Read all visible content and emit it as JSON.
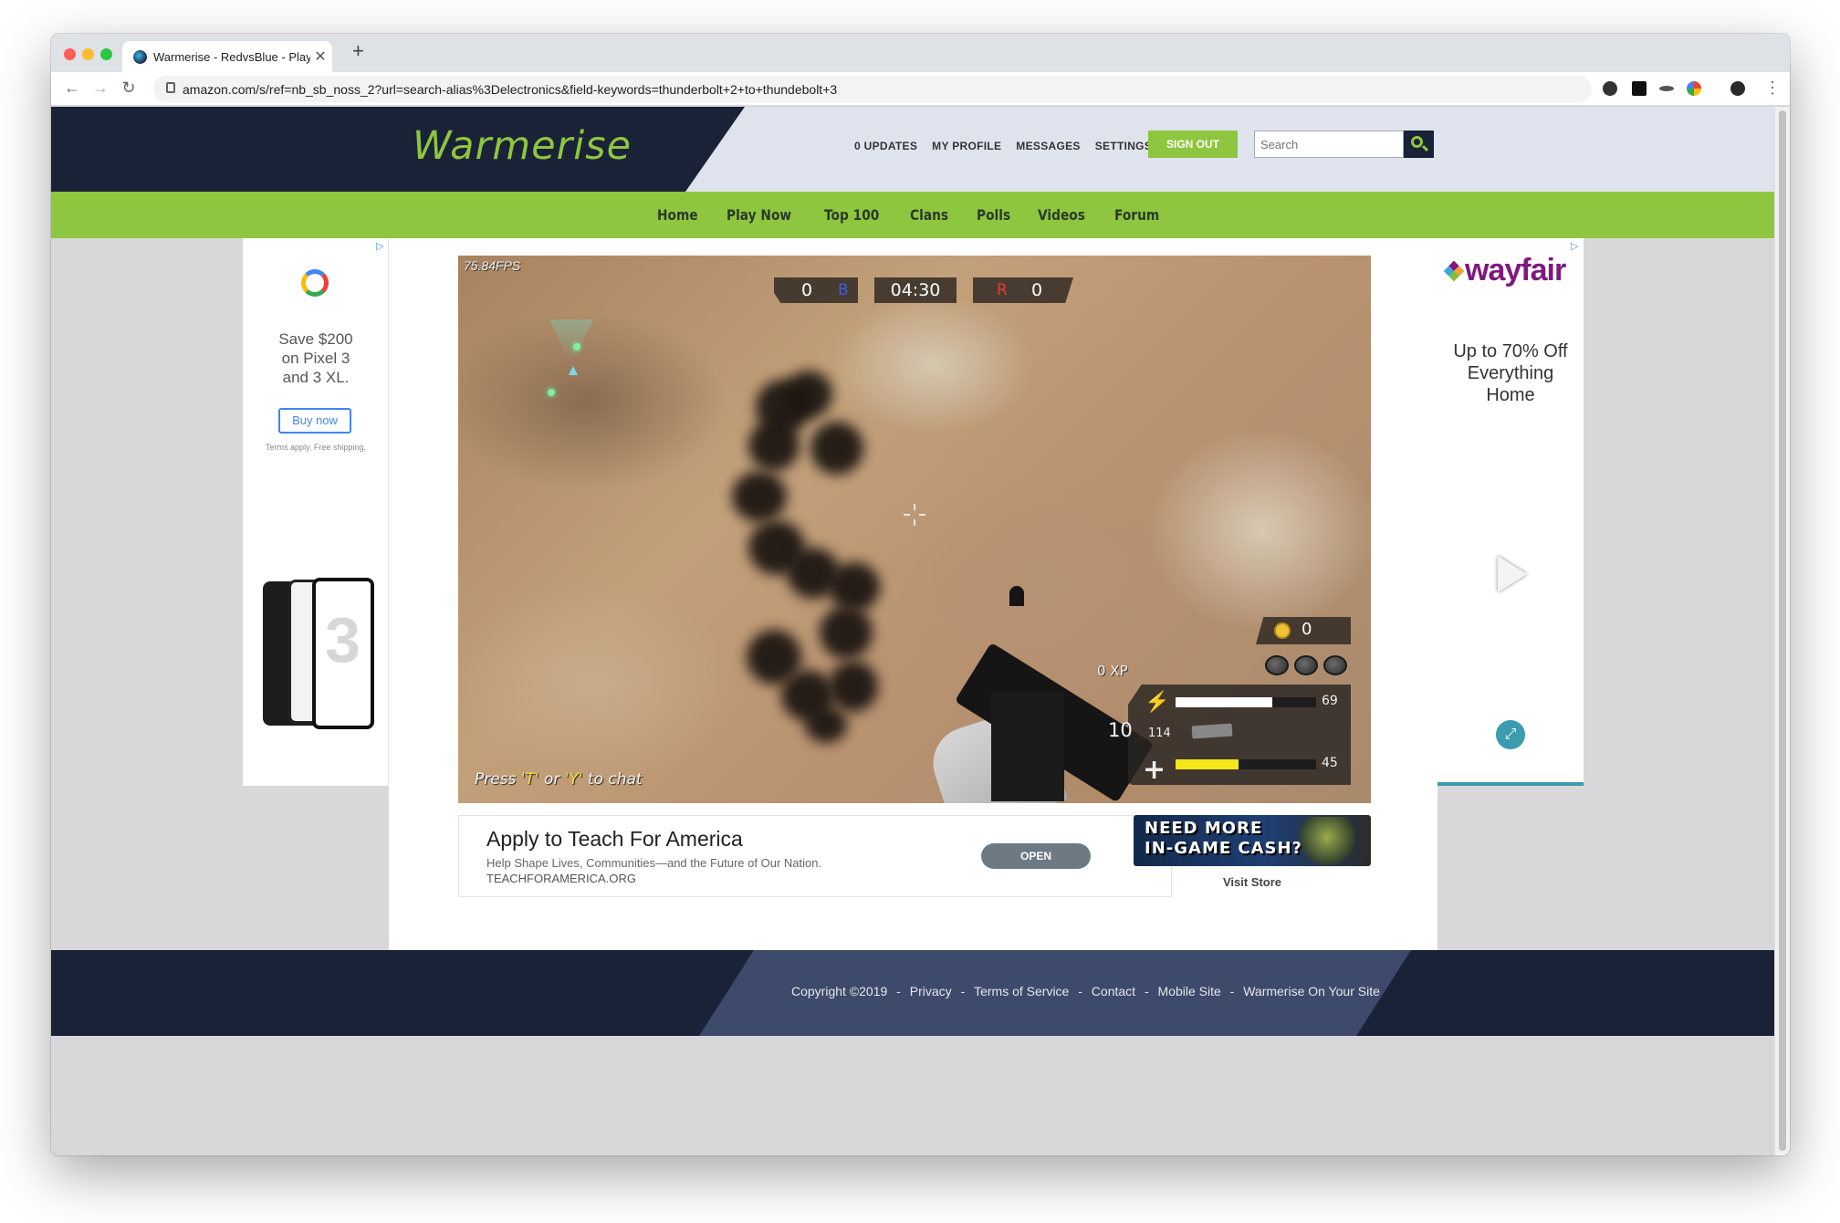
{
  "browser": {
    "tab_title": "Warmerise - RedvsBlue - Play",
    "url": "amazon.com/s/ref=nb_sb_noss_2?url=search-alias%3Delectronics&field-keywords=thunderbolt+2+to+thundebolt+3",
    "new_tab": "+",
    "close": "✕",
    "back": "←",
    "forward": "→",
    "reload": "↻",
    "menu": "⋮"
  },
  "header": {
    "logo": "Warmerise",
    "links": [
      "0 UPDATES",
      "MY PROFILE",
      "MESSAGES",
      "SETTINGS"
    ],
    "signout": "SIGN OUT",
    "search_placeholder": "Search"
  },
  "nav": {
    "items": [
      "Home",
      "Play Now",
      "Top 100",
      "Clans",
      "Polls",
      "Videos",
      "Forum"
    ]
  },
  "left_ad": {
    "adchoice": "▷",
    "headline_1": "Save $200",
    "headline_2": "on Pixel 3",
    "headline_3": "and 3 XL.",
    "button": "Buy now",
    "terms": "Terms apply. Free shipping."
  },
  "game": {
    "fps": "75.84FPS",
    "blue_score": "0",
    "blue_label": "B",
    "timer": "04:30",
    "red_label": "R",
    "red_score": "0",
    "coins": "0",
    "xp": "0 XP",
    "ammo_clip": "10",
    "ammo_reserve": "114",
    "stamina": "69",
    "stamina_fraction": 0.69,
    "health": "45",
    "health_fraction": 0.45,
    "chat_prefix": "Press ",
    "chat_key_t": "'T'",
    "chat_or": " or ",
    "chat_key_y": "'Y'",
    "chat_suffix": " to chat"
  },
  "bottom_ad": {
    "title": "Apply to Teach For America",
    "description": "Help Shape Lives, Communities—and the Future of Our Nation.",
    "domain": "TEACHFORAMERICA.ORG",
    "button": "OPEN",
    "adchoices": "▷ ✕"
  },
  "store": {
    "banner_line1": "NEED MORE",
    "banner_line2": "IN-GAME CASH?",
    "link": "Visit Store"
  },
  "right_ad": {
    "adchoice": "▷",
    "brand": "wayfair",
    "offer_1": "Up to 70% Off",
    "offer_2": "Everything",
    "offer_3": "Home",
    "expand": "⤢"
  },
  "footer": {
    "copyright": "Copyright ©2019",
    "sep": "-",
    "links": [
      "Privacy",
      "Terms of Service",
      "Contact",
      "Mobile Site",
      "Warmerise On Your Site"
    ]
  },
  "colors": {
    "brand_green": "#8ec63f",
    "brand_navy": "#1a2238",
    "stamina_bar": "#ffffff",
    "health_bar": "#f3e61a",
    "blue_team": "#3a5ee8",
    "red_team": "#e83a3a"
  }
}
